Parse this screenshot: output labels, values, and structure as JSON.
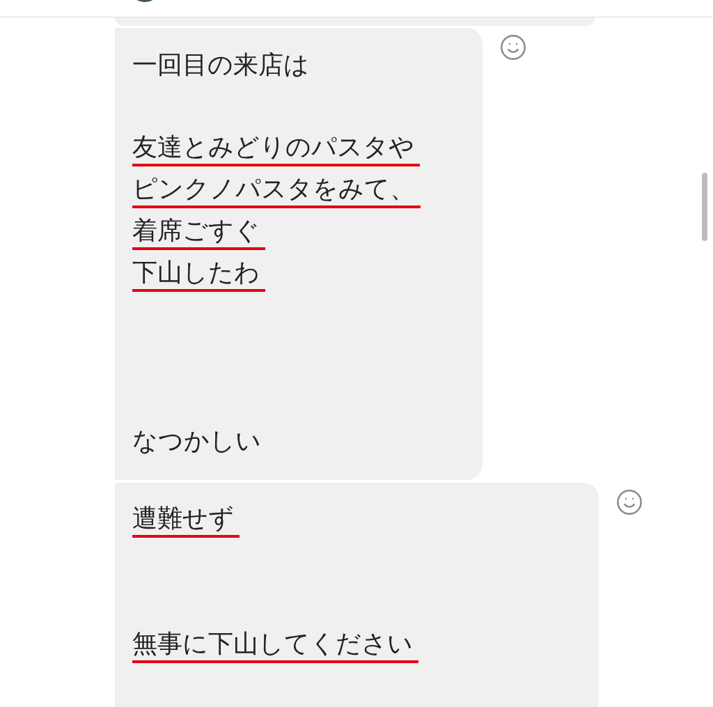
{
  "messages": [
    {
      "lines": [
        {
          "kind": "text",
          "text": "一回目の来店は",
          "underlined": false
        },
        {
          "kind": "blank"
        },
        {
          "kind": "text",
          "text": "友達とみどりのパスタや",
          "underlined": true
        },
        {
          "kind": "text",
          "text": "ピンクノパスタをみて、",
          "underlined": true
        },
        {
          "kind": "text",
          "text": "着席ごすぐ",
          "underlined": true
        },
        {
          "kind": "text",
          "text": "下山したわ",
          "underlined": true
        },
        {
          "kind": "blank"
        },
        {
          "kind": "blank"
        },
        {
          "kind": "blank"
        },
        {
          "kind": "text",
          "text": "なつかしい",
          "underlined": false
        }
      ],
      "wide": false
    },
    {
      "lines": [
        {
          "kind": "text",
          "text": "遭難せず",
          "underlined": true
        },
        {
          "kind": "blank"
        },
        {
          "kind": "blank"
        },
        {
          "kind": "text",
          "text": "無事に下山してください",
          "underlined": true
        },
        {
          "kind": "blank"
        }
      ],
      "wide": true
    }
  ]
}
